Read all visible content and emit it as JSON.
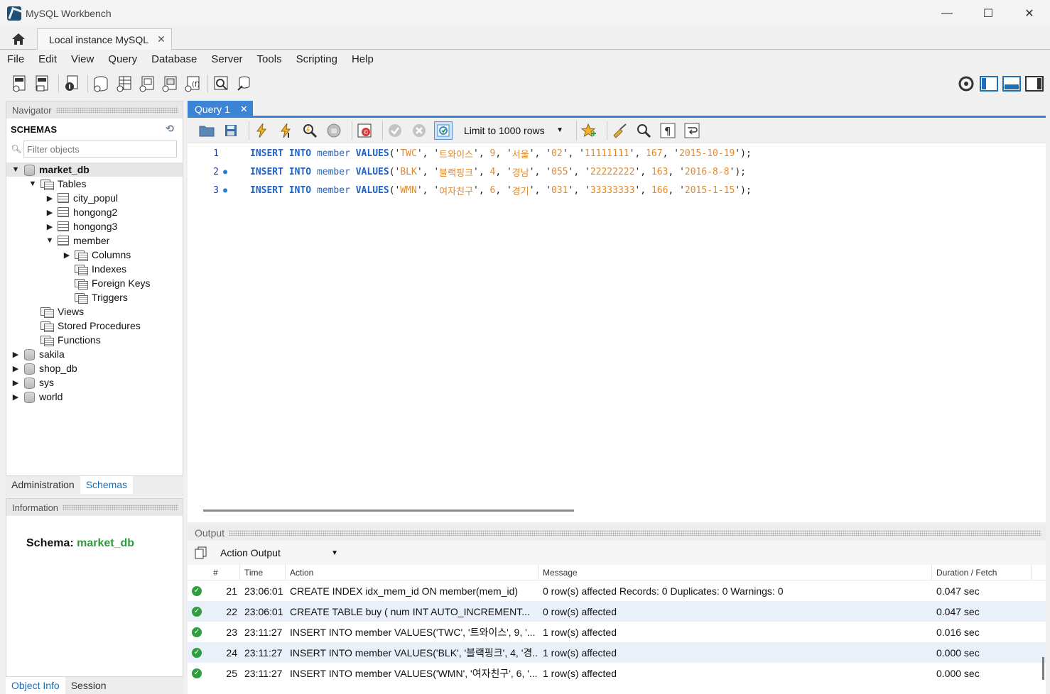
{
  "window": {
    "title": "MySQL Workbench",
    "controls": [
      "—",
      "☐",
      "✕"
    ]
  },
  "tabs": {
    "instance_label": "Local instance MySQL",
    "close": "✕"
  },
  "menu": [
    "File",
    "Edit",
    "View",
    "Query",
    "Database",
    "Server",
    "Tools",
    "Scripting",
    "Help"
  ],
  "navigator": {
    "header": "Navigator",
    "schemas_label": "SCHEMAS",
    "filter_placeholder": "Filter objects",
    "tree": {
      "market_db": "market_db",
      "tables": "Tables",
      "city_popul": "city_popul",
      "hongong2": "hongong2",
      "hongong3": "hongong3",
      "member": "member",
      "columns": "Columns",
      "indexes": "Indexes",
      "foreign_keys": "Foreign Keys",
      "triggers": "Triggers",
      "views": "Views",
      "stored_procedures": "Stored Procedures",
      "functions": "Functions",
      "sakila": "sakila",
      "shop_db": "shop_db",
      "sys": "sys",
      "world": "world"
    },
    "tab_administration": "Administration",
    "tab_schemas": "Schemas"
  },
  "information": {
    "header": "Information",
    "schema_label": "Schema:",
    "schema_value": "market_db",
    "tab_object_info": "Object Info",
    "tab_session": "Session"
  },
  "query": {
    "tab_label": "Query 1",
    "tab_close": "✕",
    "limit_label": "Limit to 1000 rows",
    "lines": [
      {
        "num": "1",
        "name": "TWC",
        "kname": "트와이스",
        "n": "9",
        "addr": "서울",
        "p1": "02",
        "p2": "11111111",
        "h": "167",
        "date": "2015-10-19"
      },
      {
        "num": "2",
        "name": "BLK",
        "kname": "블랙핑크",
        "n": "4",
        "addr": "경남",
        "p1": "055",
        "p2": "22222222",
        "h": "163",
        "date": "2016-8-8"
      },
      {
        "num": "3",
        "name": "WMN",
        "kname": "여자친구",
        "n": "6",
        "addr": "경기",
        "p1": "031",
        "p2": "33333333",
        "h": "166",
        "date": "2015-1-15"
      }
    ],
    "kw_insert": "INSERT",
    "kw_into": "INTO",
    "kw_values": "VALUES",
    "tbl": "member"
  },
  "output": {
    "header": "Output",
    "selector": "Action Output",
    "columns": [
      "#",
      "Time",
      "Action",
      "Message",
      "Duration / Fetch"
    ],
    "rows": [
      {
        "n": "21",
        "time": "23:06:01",
        "action": "CREATE INDEX idx_mem_id ON member(mem_id)",
        "message": "0 row(s) affected Records: 0  Duplicates: 0  Warnings: 0",
        "duration": "0.047 sec"
      },
      {
        "n": "22",
        "time": "23:06:01",
        "action": "CREATE TABLE buy (      num INT AUTO_INCREMENT...",
        "message": "0 row(s) affected",
        "duration": "0.047 sec"
      },
      {
        "n": "23",
        "time": "23:11:27",
        "action": "INSERT INTO member VALUES('TWC', '트와이스', 9, '...",
        "message": "1 row(s) affected",
        "duration": "0.016 sec"
      },
      {
        "n": "24",
        "time": "23:11:27",
        "action": "INSERT INTO member VALUES('BLK', '블랙핑크', 4, '경...",
        "message": "1 row(s) affected",
        "duration": "0.000 sec"
      },
      {
        "n": "25",
        "time": "23:11:27",
        "action": "INSERT INTO member VALUES('WMN', '여자친구', 6, '...",
        "message": "1 row(s) affected",
        "duration": "0.000 sec"
      }
    ]
  },
  "colors": {
    "accent": "#3c84d4",
    "keyword": "#1f63c7",
    "string": "#e08a2e",
    "success": "#2f9e3e",
    "schema_value": "#2e9a3c"
  }
}
